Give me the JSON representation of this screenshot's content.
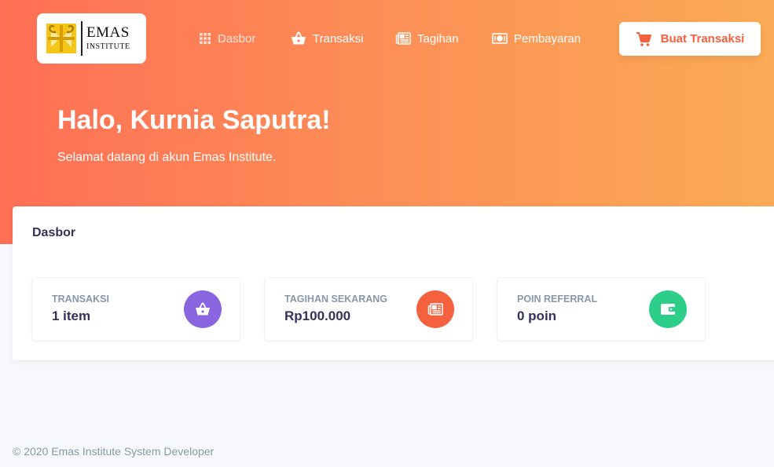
{
  "brand": {
    "line1": "EMAS",
    "line2": "INSTITUTE"
  },
  "nav": [
    {
      "label": "Dasbor",
      "icon": "grid-icon",
      "active": true
    },
    {
      "label": "Transaksi",
      "icon": "basket-icon",
      "active": false
    },
    {
      "label": "Tagihan",
      "icon": "newspaper-icon",
      "active": false
    },
    {
      "label": "Pembayaran",
      "icon": "money-icon",
      "active": false
    }
  ],
  "cta": {
    "label": "Buat Transaksi",
    "icon": "cart-icon"
  },
  "hero": {
    "greeting": "Halo, Kurnia Saputra!",
    "subtitle": "Selamat datang di akun Emas Institute."
  },
  "dashboard": {
    "title": "Dasbor",
    "stats": [
      {
        "label": "TRANSAKSI",
        "value": "1 item",
        "icon": "basket-icon",
        "color": "#8965e0"
      },
      {
        "label": "TAGIHAN SEKARANG",
        "value": "Rp100.000",
        "icon": "newspaper-icon",
        "color": "#f5603f"
      },
      {
        "label": "POIN REFERRAL",
        "value": "0 poin",
        "icon": "wallet-icon",
        "color": "#2dce89"
      }
    ]
  },
  "footer": {
    "text": "© 2020 Emas Institute System Developer"
  },
  "colors": {
    "gradient_start": "#ff6f55",
    "gradient_end": "#fbab55",
    "heading": "#32325d",
    "muted": "#8898aa",
    "cta_text": "#f5603f"
  }
}
